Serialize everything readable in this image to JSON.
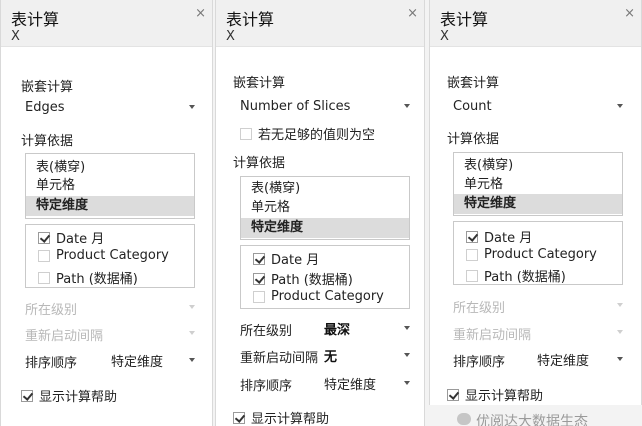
{
  "panels": [
    {
      "title": "表计算",
      "subtitle": "X",
      "close": "×",
      "nested_calc_label": "嵌套计算",
      "nested_calc_value": "Edges",
      "compute_by_label": "计算依据",
      "compute_by_options": [
        "表(横穿)",
        "单元格",
        "特定维度"
      ],
      "selected_option": 2,
      "dimensions": [
        {
          "label": "Date 月",
          "checked": true
        },
        {
          "label": "Product Category",
          "checked": false
        },
        {
          "label": "Path (数据桶)",
          "checked": false
        }
      ],
      "level_label": "所在级别",
      "level_value": "",
      "restart_label": "重新启动间隔",
      "restart_value": "",
      "sort_label": "排序顺序",
      "sort_value": "特定维度",
      "show_help_label": "显示计算帮助",
      "show_help_checked": true
    },
    {
      "title": "表计算",
      "subtitle": "X",
      "close": "×",
      "nested_calc_label": "嵌套计算",
      "nested_calc_value": "Number of Slices",
      "empty_if_insufficient_label": "若无足够的值则为空",
      "empty_if_insufficient_checked": false,
      "compute_by_label": "计算依据",
      "compute_by_options": [
        "表(横穿)",
        "单元格",
        "特定维度"
      ],
      "selected_option": 2,
      "dimensions": [
        {
          "label": "Date 月",
          "checked": true
        },
        {
          "label": "Path (数据桶)",
          "checked": true
        },
        {
          "label": "Product Category",
          "checked": false
        }
      ],
      "level_label": "所在级别",
      "level_value": "最深",
      "restart_label": "重新启动间隔",
      "restart_value": "无",
      "sort_label": "排序顺序",
      "sort_value": "特定维度",
      "show_help_label": "显示计算帮助",
      "show_help_checked": true
    },
    {
      "title": "表计算",
      "subtitle": "X",
      "close": "×",
      "nested_calc_label": "嵌套计算",
      "nested_calc_value": "Count",
      "compute_by_label": "计算依据",
      "compute_by_options": [
        "表(横穿)",
        "单元格",
        "特定维度"
      ],
      "selected_option": 2,
      "dimensions": [
        {
          "label": "Date 月",
          "checked": true
        },
        {
          "label": "Product Category",
          "checked": false
        },
        {
          "label": "Path (数据桶)",
          "checked": false
        }
      ],
      "level_label": "所在级别",
      "level_value": "",
      "restart_label": "重新启动间隔",
      "restart_value": "",
      "sort_label": "排序顺序",
      "sort_value": "特定维度",
      "show_help_label": "显示计算帮助",
      "show_help_checked": true
    }
  ],
  "watermark": "优阅达大数据生态"
}
